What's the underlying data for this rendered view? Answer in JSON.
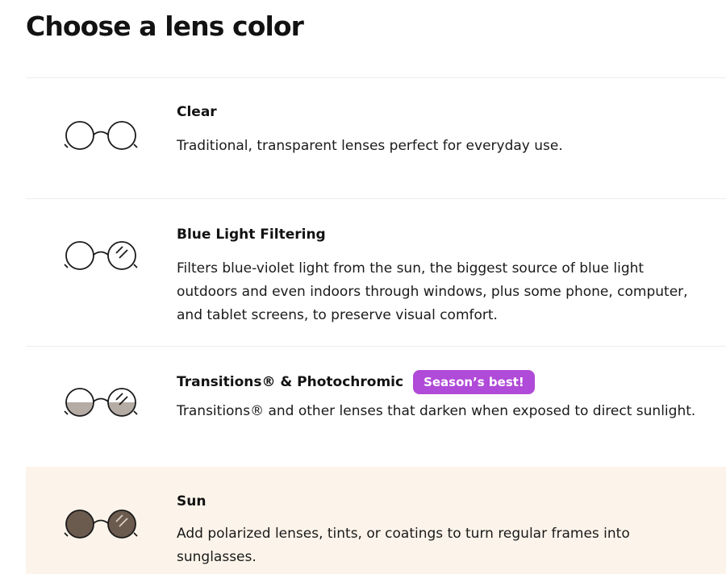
{
  "page": {
    "title": "Choose a lens color"
  },
  "options": [
    {
      "name": "Clear",
      "description": "Traditional, transparent lenses perfect for everyday use.",
      "icon": "clear-lens-glasses-icon"
    },
    {
      "name": "Blue Light Filtering",
      "description": "Filters blue-violet light from the sun, the biggest source of blue light outdoors and even indoors through windows, plus some phone, computer, and tablet screens, to preserve visual comfort.",
      "icon": "blue-light-glasses-icon"
    },
    {
      "name": "Transitions® & Photochromic",
      "badge": "Season’s best!",
      "description": "Transitions® and other lenses that darken when exposed to direct sunlight.",
      "icon": "photochromic-glasses-icon"
    },
    {
      "name": "Sun",
      "description": "Add polarized lenses, tints, or coatings to turn regular frames into sunglasses.",
      "icon": "sun-glasses-icon",
      "selected": true
    }
  ],
  "colors": {
    "badge": "#b04ad8",
    "selected_background": "#fcf4ea",
    "photochromic_tint": "#b5aca6",
    "sun_tint": "#6b5a4e",
    "divider": "#ececec"
  }
}
